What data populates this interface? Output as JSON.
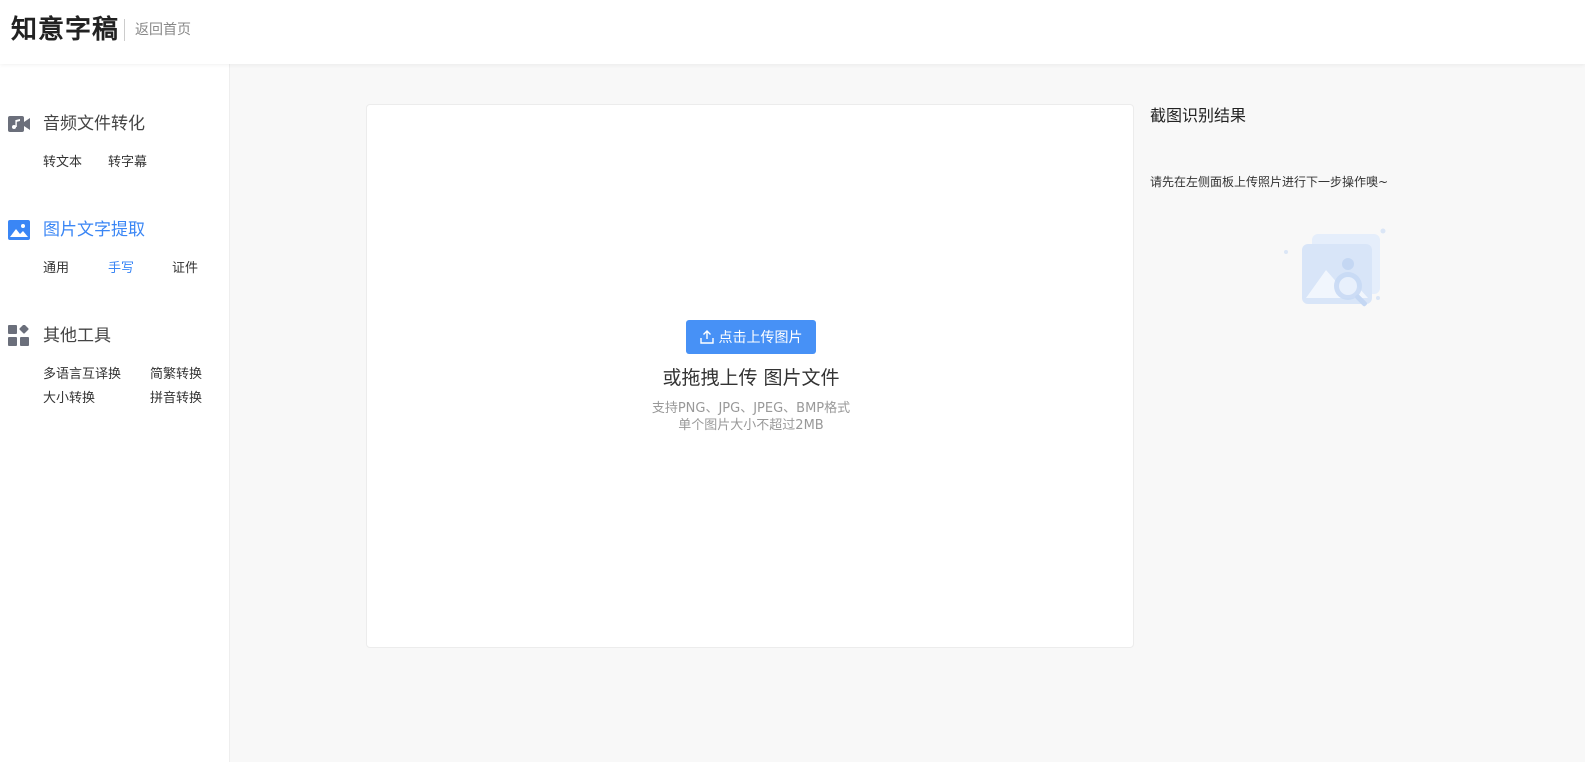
{
  "header": {
    "logo": "知意字稿",
    "back_home": "返回首页"
  },
  "sidebar": {
    "sections": [
      {
        "title": "音频文件转化",
        "icon": "music-video-icon",
        "items": [
          "转文本",
          "转字幕"
        ]
      },
      {
        "title": "图片文字提取",
        "icon": "image-icon",
        "items": [
          "通用",
          "手写",
          "证件"
        ],
        "active_item": "手写"
      },
      {
        "title": "其他工具",
        "icon": "widgets-icon",
        "items": [
          "多语言互译换",
          "简繁转换",
          "大小转换",
          "拼音转换"
        ]
      }
    ]
  },
  "upload": {
    "button_label": "点击上传图片",
    "button_icon": "upload-icon",
    "drag_text": "或拖拽上传 图片文件",
    "formats": "支持PNG、JPG、JPEG、BMP格式",
    "size_limit": "单个图片大小不超过2MB"
  },
  "result": {
    "title": "截图识别结果",
    "hint": "请先在左侧面板上传照片进行下一步操作噢~",
    "illustration": "empty-image-search-icon"
  },
  "colors": {
    "accent": "#3a86f5",
    "button": "#4791f6",
    "icon_gray": "#6b6f7b"
  }
}
